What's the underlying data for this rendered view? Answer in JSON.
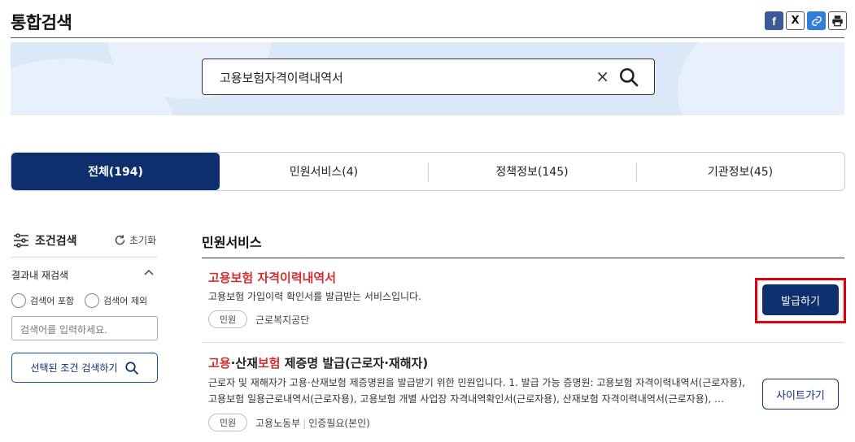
{
  "page": {
    "title": "통합검색"
  },
  "share": {
    "facebook": "f",
    "x": "X",
    "link": "🔗",
    "print": "🖨"
  },
  "search": {
    "query": "고용보험자격이력내역서",
    "clear": "×"
  },
  "tabs": [
    {
      "label": "전체(194)",
      "active": true
    },
    {
      "label": "민원서비스(4)",
      "active": false
    },
    {
      "label": "정책정보(145)",
      "active": false
    },
    {
      "label": "기관정보(45)",
      "active": false
    }
  ],
  "sidebar": {
    "title": "조건검색",
    "reset_label": "초기화",
    "refine_title": "결과내 재검색",
    "include_label": "검색어 포함",
    "exclude_label": "검색어 제외",
    "input_placeholder": "검색어를 입력하세요.",
    "apply_label": "선택된 조건 검색하기"
  },
  "results": {
    "section_title": "민원서비스",
    "items": [
      {
        "title_hl": "고용보험 자격이력내역서",
        "title_rest": "",
        "desc": "고용보험 가입이력 확인서를 발급받는 서비스입니다.",
        "badge": "민원",
        "org": "근로복지공단",
        "extra": "",
        "button": "발급하기"
      },
      {
        "title_p1": "고용",
        "title_p2": "·산재",
        "title_p3": "보험",
        "title_p4": " 제증명 발급(근로자·재해자)",
        "desc": "근로자 및 재해자가 고용·산재보험 제증명원을 발급받기 위한 민원입니다. 1. 발급 가능 증명원: 고용보험 자격이력내역서(근로자용), 고용보험 일용근로내역서(근로자용), 고용보험 개별 사업장 자격내역확인서(근로자용), 산재보험 자격이력내역서(근로자용), …",
        "badge": "민원",
        "org": "고용노동부",
        "extra": "인증필요(본인)",
        "button": "사이트가기"
      }
    ]
  },
  "colors": {
    "primary": "#0d2f6e",
    "highlight": "#d0302f",
    "banner": "#dbe8f8",
    "focus_box": "#e0000f"
  }
}
